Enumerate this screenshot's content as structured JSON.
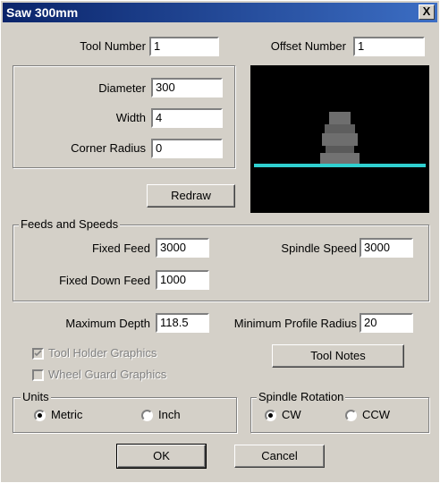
{
  "window": {
    "title": "Saw 300mm",
    "close_glyph": "X"
  },
  "tool": {
    "tool_number_label": "Tool Number",
    "tool_number": "1",
    "offset_number_label": "Offset Number",
    "offset_number": "1",
    "diameter_label": "Diameter",
    "diameter": "300",
    "width_label": "Width",
    "width": "4",
    "corner_radius_label": "Corner Radius",
    "corner_radius": "0",
    "redraw_label": "Redraw"
  },
  "feeds": {
    "group_title": "Feeds and Speeds",
    "fixed_feed_label": "Fixed Feed",
    "fixed_feed": "3000",
    "spindle_speed_label": "Spindle Speed",
    "spindle_speed": "3000",
    "fixed_down_feed_label": "Fixed Down Feed",
    "fixed_down_feed": "1000"
  },
  "limits": {
    "max_depth_label": "Maximum Depth",
    "max_depth": "118.5",
    "min_profile_radius_label": "Minimum Profile Radius",
    "min_profile_radius": "20"
  },
  "options": {
    "tool_holder_graphics_label": "Tool Holder Graphics",
    "tool_holder_graphics_checked": true,
    "wheel_guard_graphics_label": "Wheel Guard Graphics",
    "wheel_guard_graphics_checked": false,
    "tool_notes_label": "Tool Notes"
  },
  "units": {
    "group_title": "Units",
    "metric_label": "Metric",
    "inch_label": "Inch",
    "selected": "Metric"
  },
  "spindle_rotation": {
    "group_title": "Spindle Rotation",
    "cw_label": "CW",
    "ccw_label": "CCW",
    "selected": "CW"
  },
  "footer": {
    "ok_label": "OK",
    "cancel_label": "Cancel"
  },
  "colors": {
    "titlebar": "#0a246a",
    "preview_bg": "#000000",
    "blade": "#2fd0d0",
    "holder": "#6e6e6e"
  }
}
